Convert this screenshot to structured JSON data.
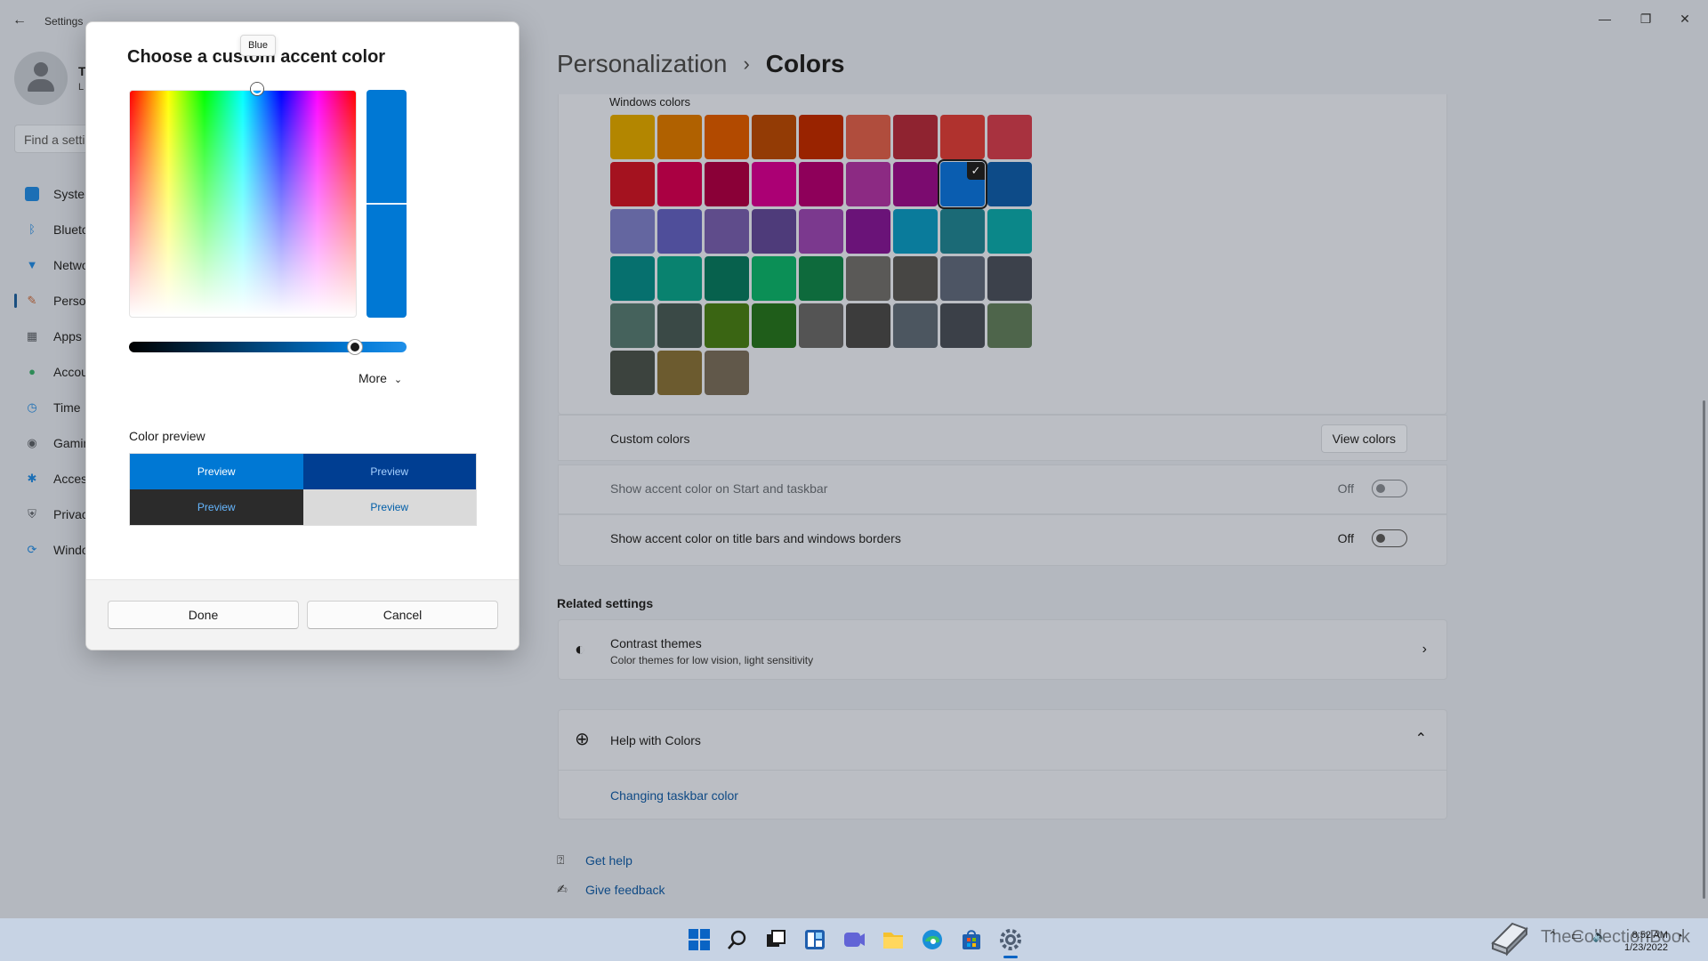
{
  "window": {
    "title": "Settings",
    "minimize_glyph": "—",
    "maximize_glyph": "❐",
    "close_glyph": "✕"
  },
  "profile": {
    "name": "T",
    "sub": "L"
  },
  "search": {
    "placeholder": "Find a setti"
  },
  "sidebar": {
    "items": [
      {
        "label": "Syster",
        "icon": "system-icon",
        "color": "#1c6fb5"
      },
      {
        "label": "Blueto",
        "icon": "bluetooth-icon",
        "color": "#1c6fb5"
      },
      {
        "label": "Netwo",
        "icon": "network-icon",
        "color": "#1c6fb5"
      },
      {
        "label": "Person",
        "icon": "brush-icon",
        "color": "#a0522d"
      },
      {
        "label": "Apps",
        "icon": "apps-icon",
        "color": "#4b4f55"
      },
      {
        "label": "Accou",
        "icon": "account-icon",
        "color": "#2e8b57"
      },
      {
        "label": "Time",
        "icon": "time-icon",
        "color": "#1c6fb5"
      },
      {
        "label": "Gamin",
        "icon": "gaming-icon",
        "color": "#4b4f55"
      },
      {
        "label": "Acces",
        "icon": "accessibility-icon",
        "color": "#1c6fb5"
      },
      {
        "label": "Privac",
        "icon": "shield-icon",
        "color": "#4b4f55"
      },
      {
        "label": "Windo",
        "icon": "windows-update-icon",
        "color": "#1c6fb5"
      }
    ]
  },
  "header": {
    "parent": "Personalization",
    "separator": "›",
    "current": "Colors"
  },
  "colors_section": {
    "label": "Windows colors",
    "swatches": [
      "#b38600",
      "#b06100",
      "#b24a00",
      "#933b05",
      "#992300",
      "#b04d3d",
      "#8f2330",
      "#b0322e",
      "#a8323f",
      "#a4121f",
      "#aa0042",
      "#8a0037",
      "#ab0074",
      "#8e005a",
      "#8c2a83",
      "#7b0b6f",
      "#0a5db0",
      "#0d4b88",
      "#6466a0",
      "#4f4e9a",
      "#5f4c8b",
      "#4e3b7a",
      "#7b398e",
      "#6a1378",
      "#0a7b9b",
      "#1b6a76",
      "#0b8789",
      "#06706e",
      "#09826f",
      "#07614d",
      "#0b8f56",
      "#0e6a3c",
      "#5a5957",
      "#474644",
      "#4d5564",
      "#3c414b",
      "#45625c",
      "#3a4946",
      "#3a6513",
      "#1f5d1a",
      "#545454",
      "#3c3c3c",
      "#4c5660",
      "#3b4048",
      "#4e654b",
      "#3c433e",
      "#6c5b2f",
      "#61584a"
    ],
    "selected_index": 16,
    "check_glyph": "✓"
  },
  "rows": {
    "custom_colors": {
      "label": "Custom colors",
      "button": "View colors"
    },
    "accent_start": {
      "label": "Show accent color on Start and taskbar",
      "state": "Off"
    },
    "accent_titlebars": {
      "label": "Show accent color on title bars and windows borders",
      "state": "Off"
    }
  },
  "related": {
    "title": "Related settings",
    "contrast": {
      "title": "Contrast themes",
      "subtitle": "Color themes for low vision, light sensitivity"
    },
    "help": {
      "title": "Help with Colors",
      "link": "Changing taskbar color"
    }
  },
  "bottom_links": {
    "get_help": "Get help",
    "feedback": "Give feedback"
  },
  "dialog": {
    "title": "Choose a custom accent color",
    "tooltip": "Blue",
    "selected_color": "#0078d4",
    "value_level": 0.8,
    "more": "More",
    "preview_label": "Color preview",
    "preview_text": "Preview",
    "done": "Done",
    "cancel": "Cancel"
  },
  "taskbar": {
    "time": "8:52 AM",
    "date": "1/23/2022",
    "watermark": "TheCollectionBook"
  }
}
